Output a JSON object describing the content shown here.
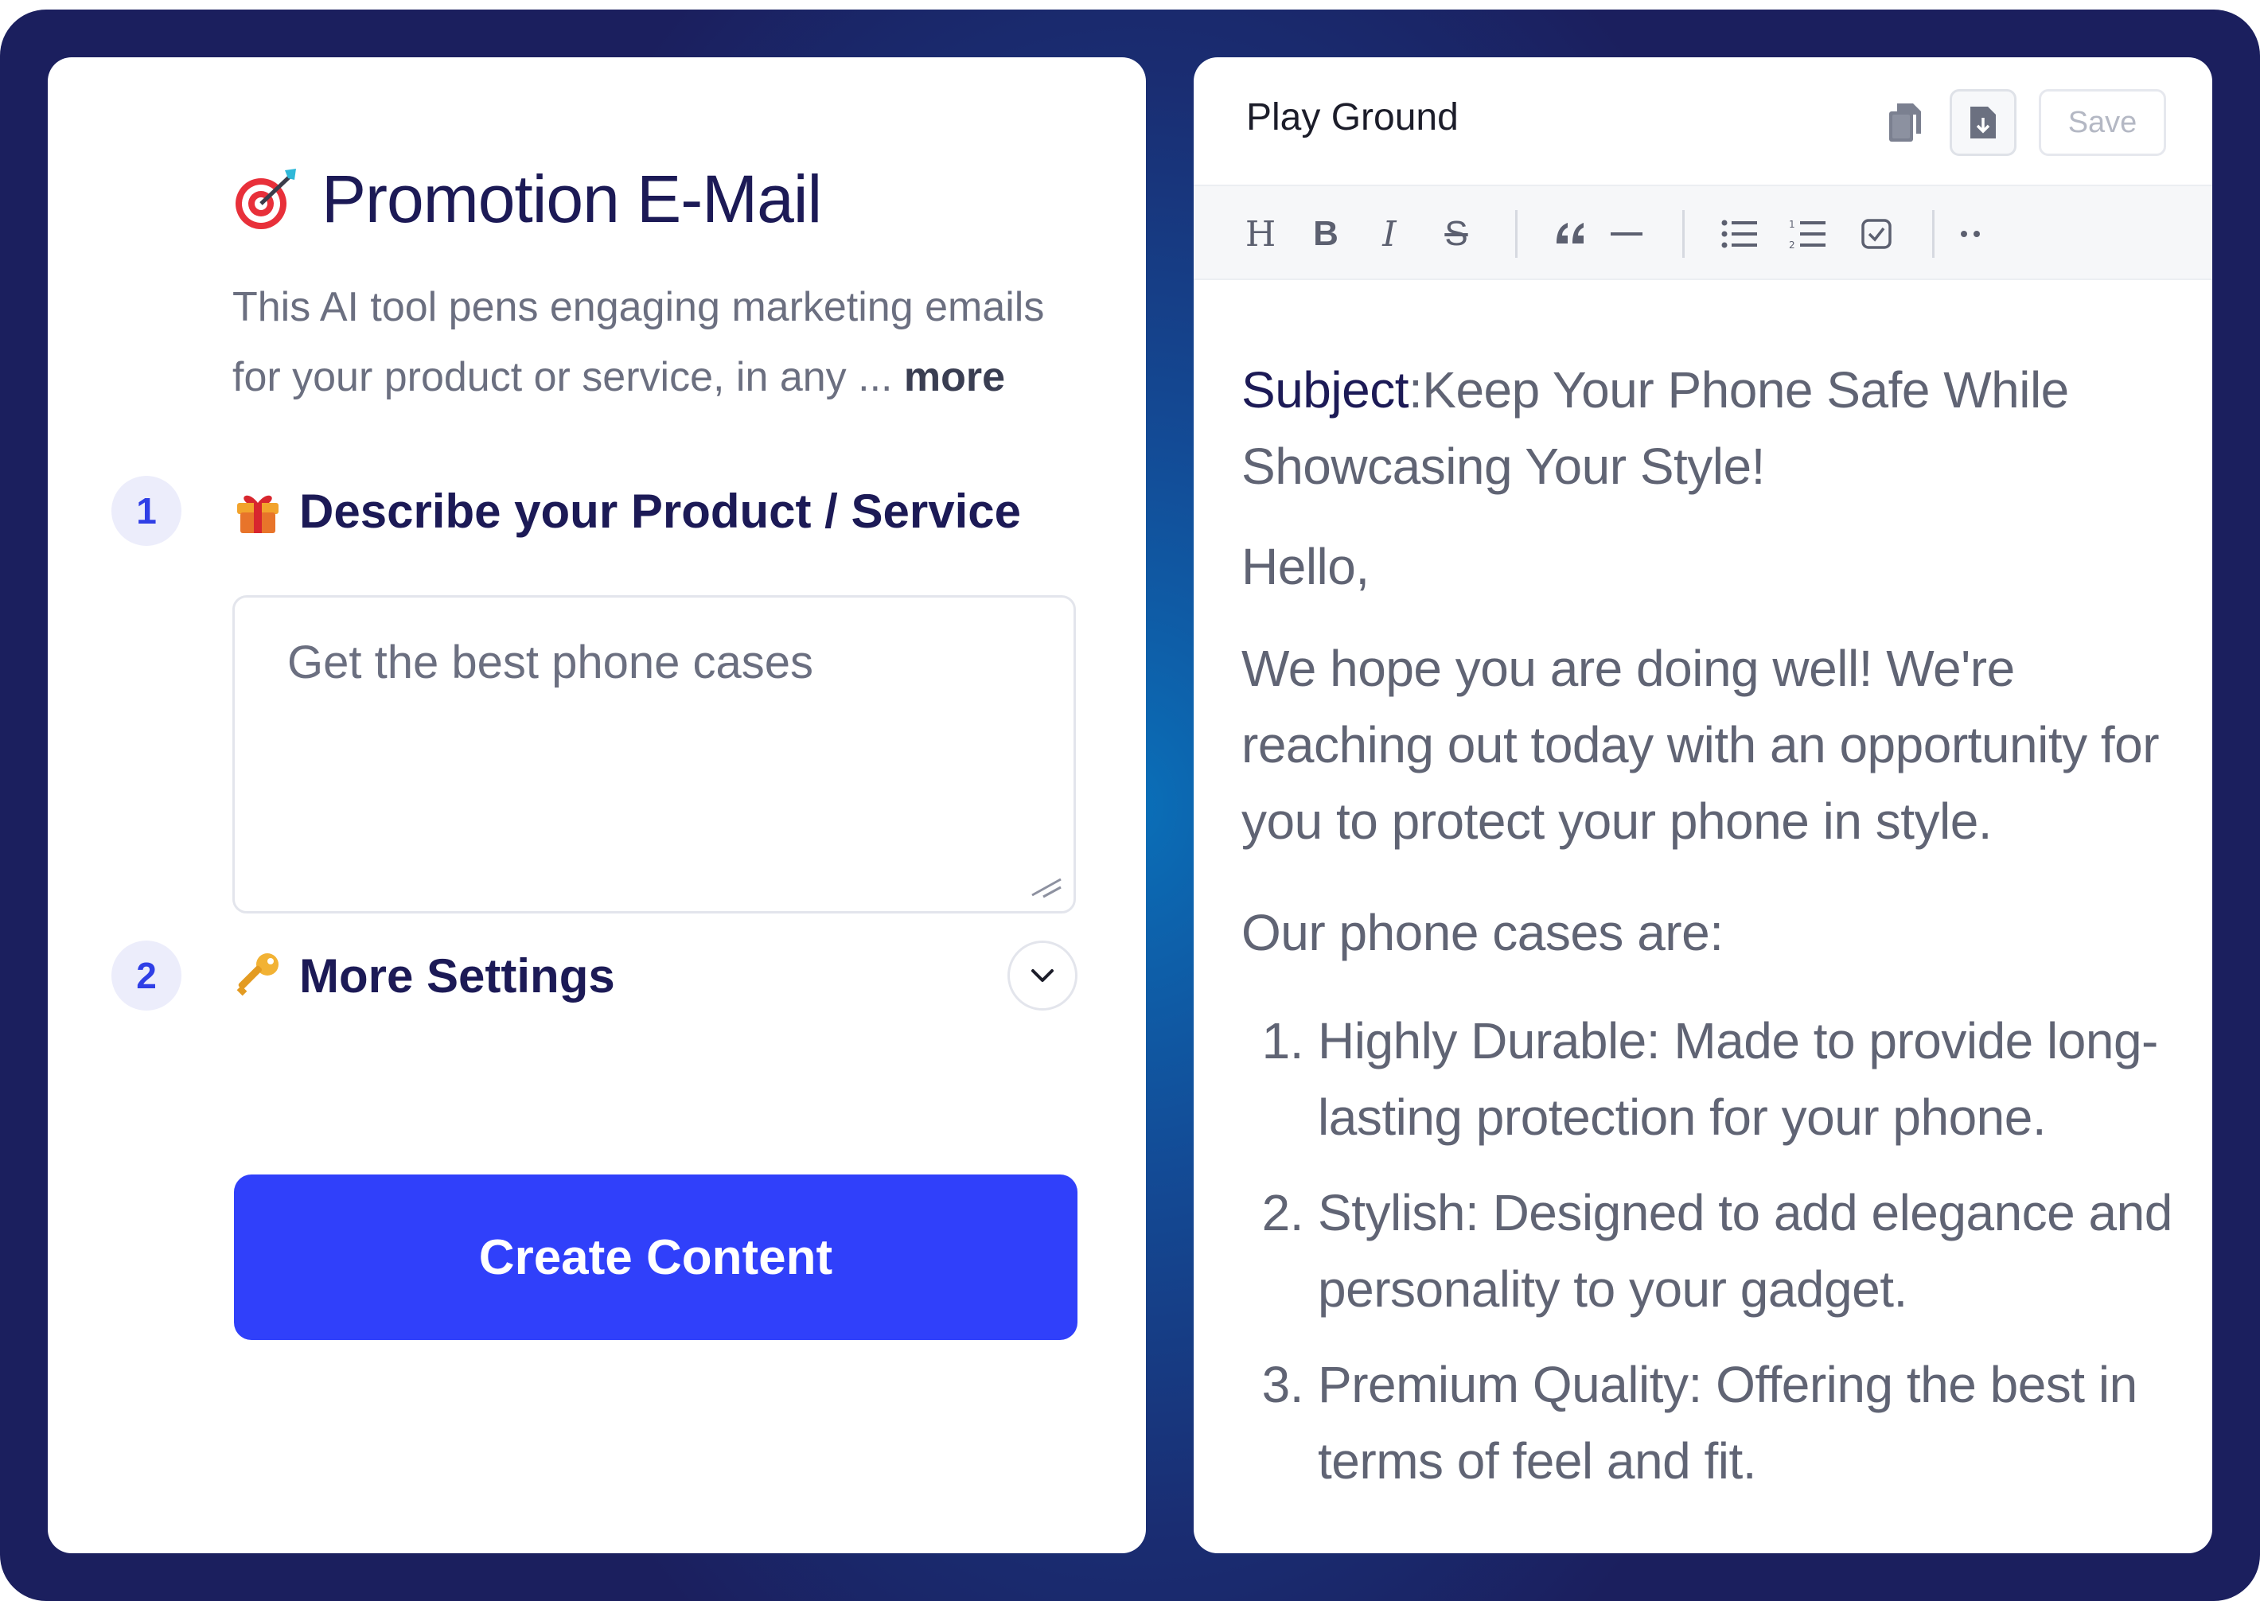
{
  "left_panel": {
    "tool_title": "Promotion E-Mail",
    "tool_icon": "target-dart-emoji",
    "description": "This AI tool pens engaging marketing emails for your product or service, in any ...",
    "more_label": "more",
    "step1": {
      "number": "1",
      "label": "Describe your Product / Service",
      "icon": "gift-emoji"
    },
    "product_input": {
      "value": "Get the best phone cases"
    },
    "step2": {
      "number": "2",
      "label": "More Settings",
      "icon": "key-emoji"
    },
    "create_button": "Create Content"
  },
  "right_panel": {
    "title": "Play Ground",
    "save_label": "Save",
    "toolbar": {
      "heading": "H",
      "bold": "B",
      "italic": "I",
      "strike": "S"
    },
    "email": {
      "subject_key": "Subject",
      "subject_value": ":Keep Your Phone Safe While Showcasing Your Style!",
      "greeting": "Hello,",
      "intro": "We hope you are doing well! We're reaching out today with an opportunity for you to protect your phone in style.",
      "list_intro": "Our phone cases are:",
      "list": [
        {
          "num": "1.",
          "text": "Highly Durable: Made to provide long-lasting protection for your phone."
        },
        {
          "num": "2.",
          "text": "Stylish: Designed to add elegance and personality to your gadget."
        },
        {
          "num": "3.",
          "text": "Premium Quality: Offering the best in terms of feel and fit."
        }
      ]
    }
  },
  "colors": {
    "primary_button": "#3040fa",
    "title_text": "#1c1a56",
    "body_text": "#606474",
    "background_dark": "#1b1f5e"
  }
}
